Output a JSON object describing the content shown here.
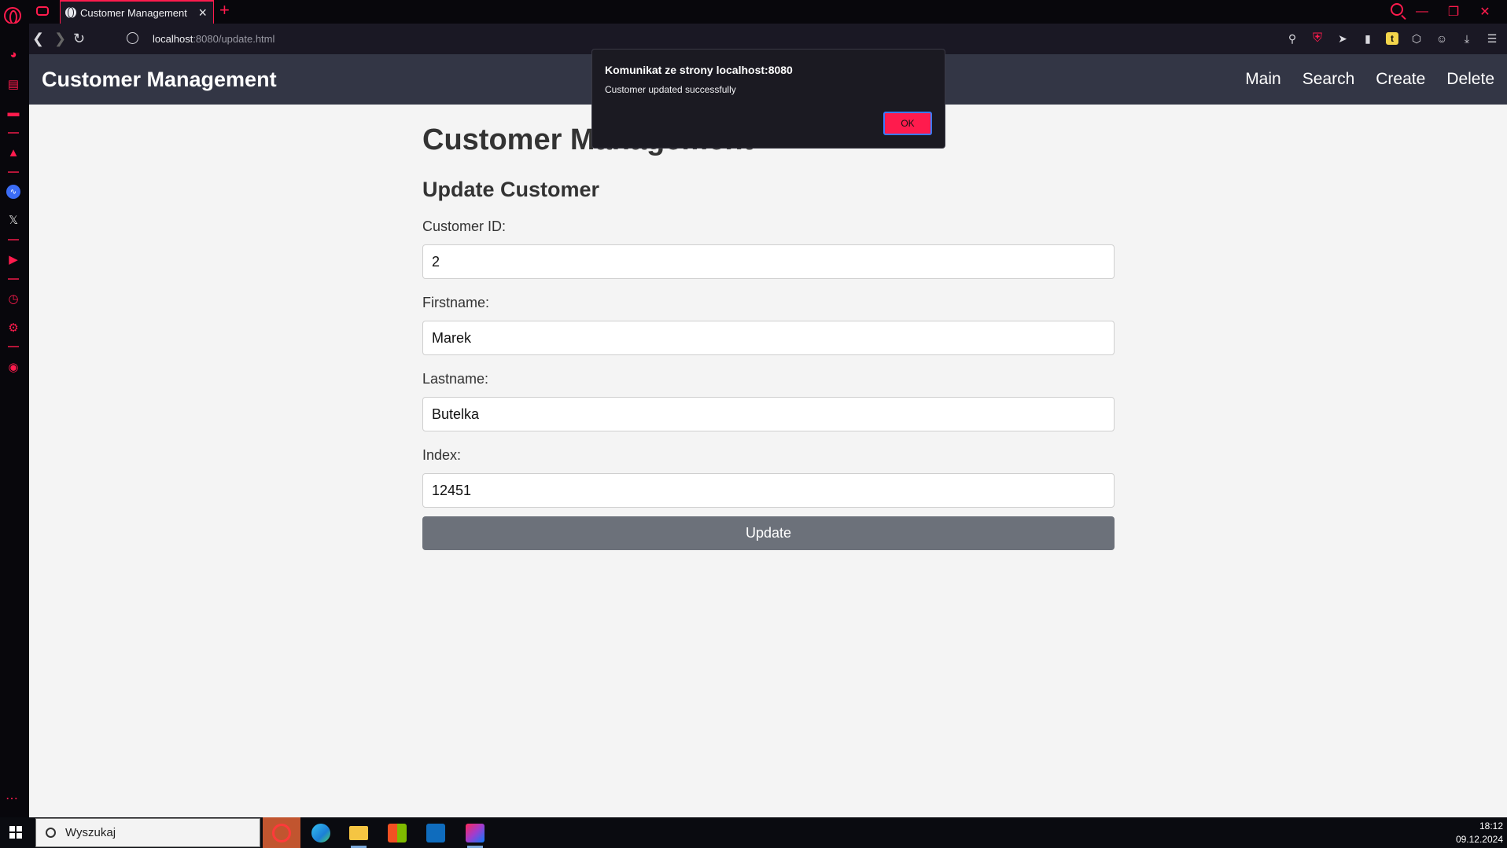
{
  "browser": {
    "tab_title": "Customer Management",
    "tab_close": "×",
    "new_tab": "+",
    "url_host": "localhost",
    "url_rest": ":8080/update.html"
  },
  "header": {
    "brand": "Customer Management",
    "nav": [
      "Main",
      "Search",
      "Create",
      "Delete"
    ]
  },
  "main": {
    "page_title": "Customer Management",
    "section_title": "Update Customer",
    "fields": [
      {
        "label": "Customer ID:",
        "value": "2"
      },
      {
        "label": "Firstname:",
        "value": "Marek"
      },
      {
        "label": "Lastname:",
        "value": "Butelka"
      },
      {
        "label": "Index:",
        "value": "12451"
      }
    ],
    "submit_label": "Update"
  },
  "dialog": {
    "title": "Komunikat ze strony localhost:8080",
    "message": "Customer updated successfully",
    "ok_label": "OK"
  },
  "taskbar": {
    "search_text": "Wyszukaj",
    "time": "18:12",
    "date": "09.12.2024"
  },
  "colors": {
    "opera_accent": "#ff1b4d",
    "header_bg": "#333645",
    "page_bg": "#f4f4f4",
    "update_button": "#6c717a"
  }
}
